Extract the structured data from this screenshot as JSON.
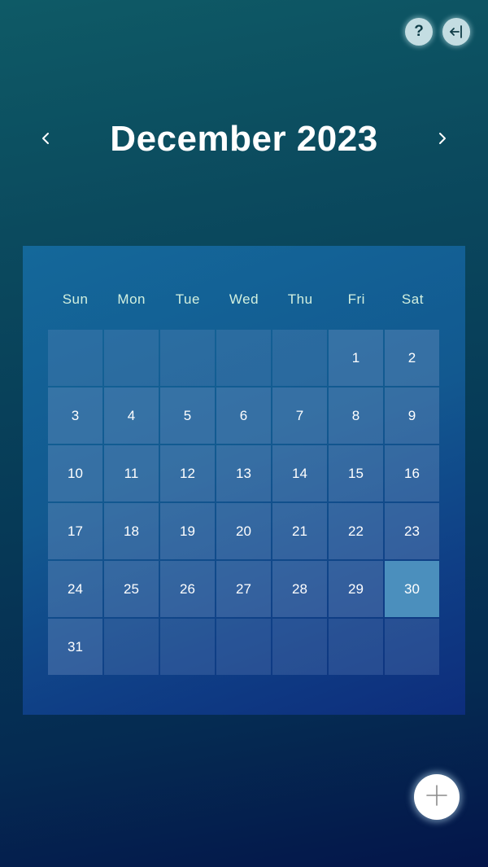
{
  "header": {
    "month_title": "December 2023",
    "prev_icon": "chevron-left-icon",
    "next_icon": "chevron-right-icon"
  },
  "top_actions": {
    "help_label": "?",
    "help_icon": "help-icon",
    "logout_icon": "logout-icon"
  },
  "calendar": {
    "weekdays": [
      "Sun",
      "Mon",
      "Tue",
      "Wed",
      "Thu",
      "Fri",
      "Sat"
    ],
    "cells": [
      "",
      "",
      "",
      "",
      "",
      "1",
      "2",
      "3",
      "4",
      "5",
      "6",
      "7",
      "8",
      "9",
      "10",
      "11",
      "12",
      "13",
      "14",
      "15",
      "16",
      "17",
      "18",
      "19",
      "20",
      "21",
      "22",
      "23",
      "24",
      "25",
      "26",
      "27",
      "28",
      "29",
      "30",
      "31",
      "",
      "",
      "",
      "",
      "",
      ""
    ],
    "highlighted_day": "30"
  },
  "fab": {
    "icon": "plus-icon"
  },
  "colors": {
    "panel": "#125990",
    "weekday_text": "#d2f0df",
    "highlight": "#4b8fbd",
    "round_button": "#c4dde2"
  }
}
